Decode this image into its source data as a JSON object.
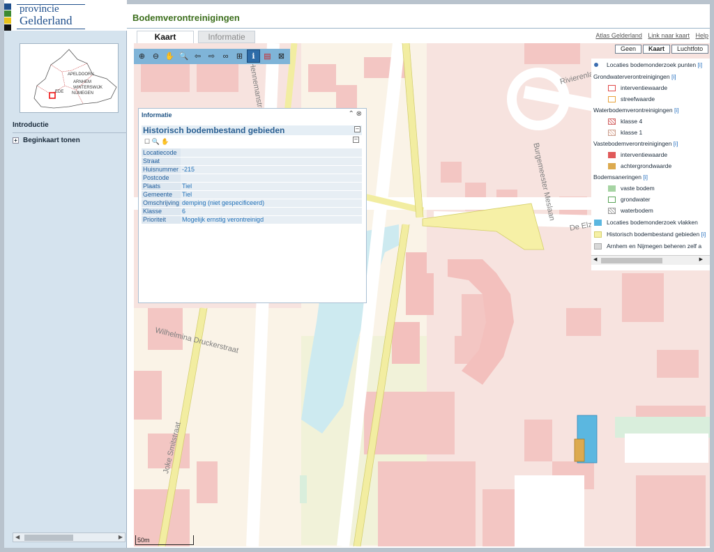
{
  "logo": {
    "line1": "provincie",
    "line2": "Gelderland"
  },
  "overview": {
    "labels": [
      "APELDOORN",
      "ARNHEM",
      "WINTERSWIJK",
      "NIJMEGEN",
      "EDE"
    ]
  },
  "sidebar": {
    "items": [
      {
        "label": "Introductie"
      },
      {
        "label": "Beginkaart tonen"
      }
    ]
  },
  "header": {
    "title": "Bodemverontreinigingen"
  },
  "tabs": [
    {
      "label": "Kaart"
    },
    {
      "label": "Informatie"
    }
  ],
  "links": [
    "Atlas Gelderland",
    "Link naar kaart",
    "Help"
  ],
  "layer_buttons": [
    "Geen",
    "Kaart",
    "Luchtfoto"
  ],
  "toolbar": {
    "tools": [
      "zoom-in-icon",
      "zoom-out-icon",
      "pan-icon",
      "zoom-extent-icon",
      "back-icon",
      "forward-icon",
      "binoculars-icon",
      "measure-icon",
      "info-icon",
      "pdf-icon",
      "print-icon"
    ]
  },
  "info_panel": {
    "title": "Informatie",
    "subtitle": "Historisch bodembestand gebieden",
    "rows": [
      {
        "key": "Locatiecode",
        "value": ""
      },
      {
        "key": "Straat",
        "value": ""
      },
      {
        "key": "Huisnummer",
        "value": "-215"
      },
      {
        "key": "Postcode",
        "value": ""
      },
      {
        "key": "Plaats",
        "value": "Tiel"
      },
      {
        "key": "Gemeente",
        "value": "Tiel"
      },
      {
        "key": "Omschrijving",
        "value": "demping (niet gespecificeerd)"
      },
      {
        "key": "Klasse",
        "value": "6"
      },
      {
        "key": "Prioriteit",
        "value": "Mogelijk ernstig verontreinigd"
      }
    ]
  },
  "legend": {
    "locaties_punten": "Locaties bodemonderzoek punten",
    "info": "[i]",
    "grondwater": {
      "title": "Grondwaterverontreinigingen",
      "items": [
        "interventiewaarde",
        "streefwaarde"
      ]
    },
    "waterbodem": {
      "title": "Waterbodemverontreinigingen",
      "items": [
        "klasse 4",
        "klasse 1"
      ]
    },
    "vastebodem": {
      "title": "Vastebodemverontreinigingen",
      "items": [
        "interventiewaarde",
        "achtergrondwaarde"
      ]
    },
    "saneringen": {
      "title": "Bodemsaneringen",
      "items": [
        "vaste bodem",
        "grondwater",
        "waterbodem"
      ]
    },
    "vlakken": "Locaties bodemonderzoek vlakken",
    "historisch": "Historisch bodembestand gebieden",
    "arnhem": "Arnhem en Nijmegen beheren zelf a",
    "colors": {
      "punten": "#3b6db0",
      "gw_interventie": "#e04848",
      "gw_streef": "#e8a23a",
      "vb_interventie": "#e05a5a",
      "vb_achtergrond": "#dcaa4f",
      "san_vaste": "#a6d4a3",
      "san_grond": "#5aa457",
      "vlakken": "#5bb7e0",
      "historisch": "#f6f0a6",
      "arnhem": "#d8d8d8"
    }
  },
  "streets": [
    "Rivierenlaan",
    "Burgemeester Meslaan",
    "De Elz",
    "Wilhelmina Druckerstraat",
    "Joke Smitstraat",
    "Hennemanstraat"
  ],
  "scale": "50m"
}
